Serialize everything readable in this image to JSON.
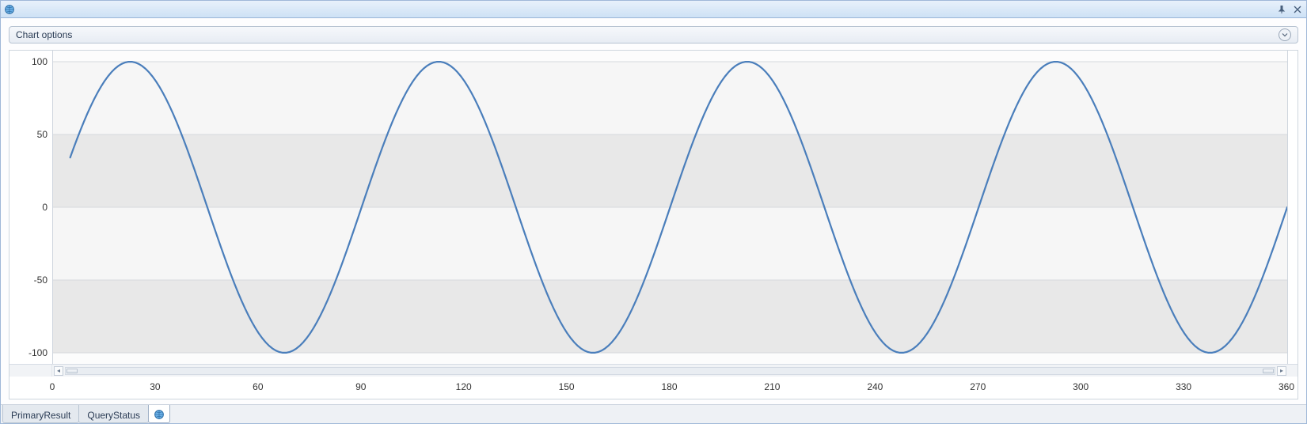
{
  "header": {
    "title": "",
    "pin_tooltip": "Auto Hide",
    "close_tooltip": "Close"
  },
  "options": {
    "label": "Chart options"
  },
  "tabs": [
    {
      "label": "PrimaryResult",
      "active": false
    },
    {
      "label": "QueryStatus",
      "active": false
    }
  ],
  "chart_data": {
    "type": "line",
    "title": "",
    "xlabel": "",
    "ylabel": "",
    "xlim": [
      0,
      360
    ],
    "ylim": [
      -100,
      100
    ],
    "x_ticks": [
      0,
      30,
      60,
      90,
      120,
      150,
      180,
      210,
      240,
      270,
      300,
      330,
      360
    ],
    "y_ticks": [
      -100,
      -50,
      0,
      50,
      100
    ],
    "x_start": 5,
    "series": [
      {
        "name": "sine",
        "color": "#4a7ebb",
        "formula": "100 * sin(4 * x_deg)",
        "cycles_over_range": 4,
        "amplitude": 100
      }
    ]
  }
}
